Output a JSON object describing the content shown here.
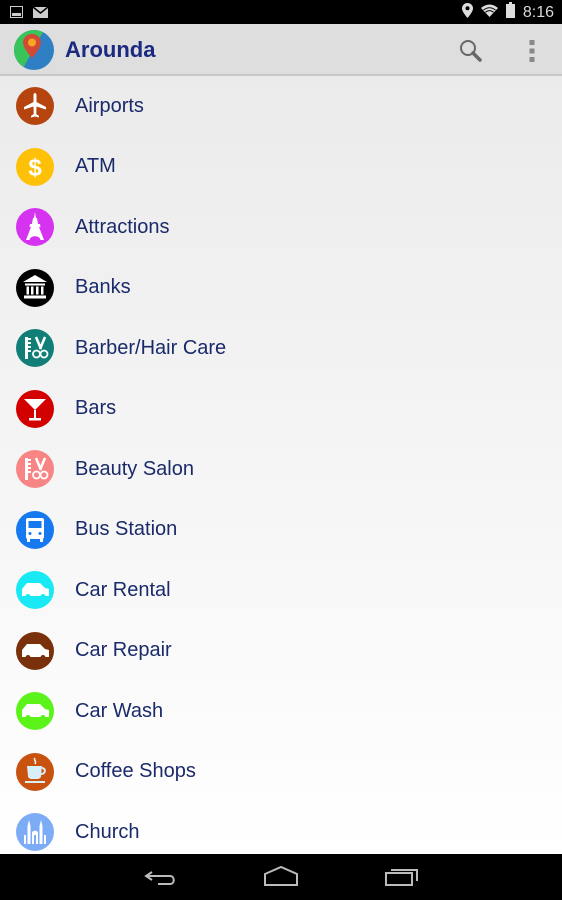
{
  "status_bar": {
    "time": "8:16",
    "left_icons": [
      "image-notification-icon",
      "mail-notification-icon"
    ],
    "right_icons": [
      "location-icon",
      "wifi-icon",
      "battery-icon"
    ]
  },
  "app_bar": {
    "title": "Arounda",
    "logo_icon": "map-pin-globe-icon",
    "actions": [
      {
        "name": "search",
        "icon": "search-icon"
      },
      {
        "name": "overflow-menu",
        "icon": "more-vert-icon"
      }
    ]
  },
  "categories": [
    {
      "label": "Airports",
      "icon": "airplane-icon",
      "color": "#b5440f"
    },
    {
      "label": "ATM",
      "icon": "dollar-icon",
      "color": "#ffc107"
    },
    {
      "label": "Attractions",
      "icon": "eiffel-tower-icon",
      "color": "#d633f0"
    },
    {
      "label": "Banks",
      "icon": "bank-icon",
      "color": "#000000"
    },
    {
      "label": "Barber/Hair Care",
      "icon": "comb-scissors-icon",
      "color": "#117f78"
    },
    {
      "label": "Bars",
      "icon": "cocktail-icon",
      "color": "#d30000"
    },
    {
      "label": "Beauty Salon",
      "icon": "comb-scissors-icon",
      "color": "#f88585"
    },
    {
      "label": "Bus Station",
      "icon": "bus-icon",
      "color": "#1679f0"
    },
    {
      "label": "Car Rental",
      "icon": "car-icon",
      "color": "#19e8f5"
    },
    {
      "label": "Car Repair",
      "icon": "car-icon",
      "color": "#7a300a"
    },
    {
      "label": "Car Wash",
      "icon": "car-icon",
      "color": "#5cf31a"
    },
    {
      "label": "Coffee Shops",
      "icon": "coffee-cup-icon",
      "color": "#c9520f"
    },
    {
      "label": "Church",
      "icon": "church-icon",
      "color": "#7cacf5"
    }
  ],
  "nav_bar": {
    "buttons": [
      {
        "name": "back",
        "icon": "back-icon"
      },
      {
        "name": "home",
        "icon": "home-icon"
      },
      {
        "name": "recents",
        "icon": "recents-icon"
      }
    ]
  }
}
